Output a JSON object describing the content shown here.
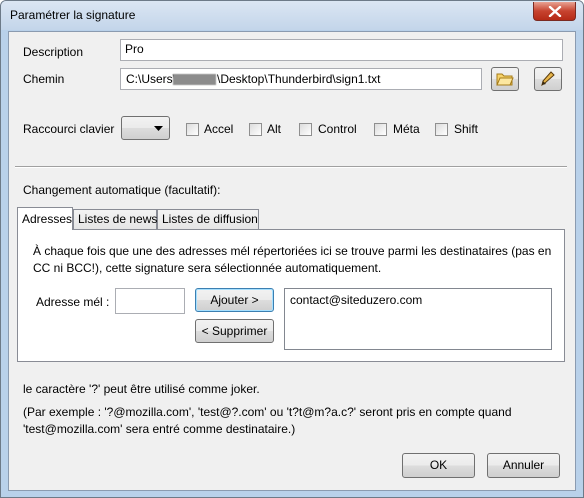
{
  "window": {
    "title": "Paramétrer la signature"
  },
  "form": {
    "description_label": "Description",
    "description_value": "Pro",
    "path_label": "Chemin",
    "path_prefix": "C:\\Users\\",
    "path_suffix": "\\Desktop\\Thunderbird\\sign1.txt",
    "shortcut_label": "Raccourci clavier",
    "modifiers": [
      "Accel",
      "Alt",
      "Control",
      "Méta",
      "Shift"
    ]
  },
  "auto": {
    "heading": "Changement automatique (facultatif):",
    "tabs": [
      "Adresses",
      "Listes de news",
      "Listes de diffusion"
    ],
    "description": "À chaque fois que une des adresses mél répertoriées ici se trouve parmi les destinataires (pas en CC ni BCC!), cette signature sera sélectionnée automatiquement.",
    "email_label": "Adresse mél :",
    "email_value": "",
    "add_button": "Ajouter >",
    "remove_button": "< Supprimer",
    "addresses": [
      "contact@siteduzero.com"
    ]
  },
  "notes": {
    "joker": "le caractère '?' peut être utilisé comme joker.",
    "example": "(Par exemple : '?@mozilla.com', 'test@?.com' ou 't?t@m?a.c?' seront pris en compte quand 'test@mozilla.com' sera entré comme destinataire.)"
  },
  "buttons": {
    "ok": "OK",
    "cancel": "Annuler"
  }
}
